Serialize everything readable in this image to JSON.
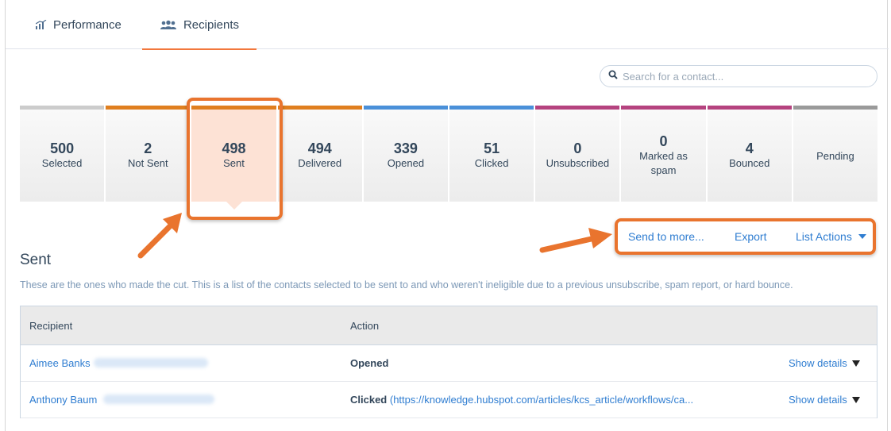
{
  "tabs": [
    {
      "label": "Performance",
      "icon": "bar-chart-icon"
    },
    {
      "label": "Recipients",
      "icon": "people-icon",
      "active": true
    }
  ],
  "search": {
    "placeholder": "Search for a contact..."
  },
  "stats": [
    {
      "value": "500",
      "label": "Selected",
      "color": "#cccccc"
    },
    {
      "value": "2",
      "label": "Not Sent",
      "color": "#e07f1f"
    },
    {
      "value": "498",
      "label": "Sent",
      "color": "#e07f1f",
      "active": true
    },
    {
      "value": "494",
      "label": "Delivered",
      "color": "#e07f1f"
    },
    {
      "value": "339",
      "label": "Opened",
      "color": "#4a90d9"
    },
    {
      "value": "51",
      "label": "Clicked",
      "color": "#4a90d9"
    },
    {
      "value": "0",
      "label": "Unsubscribed",
      "color": "#b5437f"
    },
    {
      "value": "0",
      "label": "Marked as spam",
      "color": "#b5437f"
    },
    {
      "value": "4",
      "label": "Bounced",
      "color": "#b5437f"
    },
    {
      "value": "",
      "label": "Pending",
      "color": "#9a9a9a"
    }
  ],
  "actions": {
    "send_more": "Send to more...",
    "export": "Export",
    "list_actions": "List Actions"
  },
  "section": {
    "title": "Sent",
    "description": "These are the ones who made the cut. This is a list of the contacts selected to be sent to and who weren't ineligible due to a previous unsubscribe, spam report, or hard bounce."
  },
  "table": {
    "columns": [
      "Recipient",
      "Action"
    ],
    "rows": [
      {
        "name": "Aimee Banks",
        "action": "Opened",
        "url": "",
        "details": "Show details"
      },
      {
        "name": "Anthony Baum",
        "action": "Clicked",
        "url": "(https://knowledge.hubspot.com/articles/kcs_article/workflows/ca...",
        "details": "Show details"
      }
    ]
  },
  "colors": {
    "accent": "#f2773c",
    "link": "#2f7dd1",
    "highlight": "#e9742e"
  }
}
